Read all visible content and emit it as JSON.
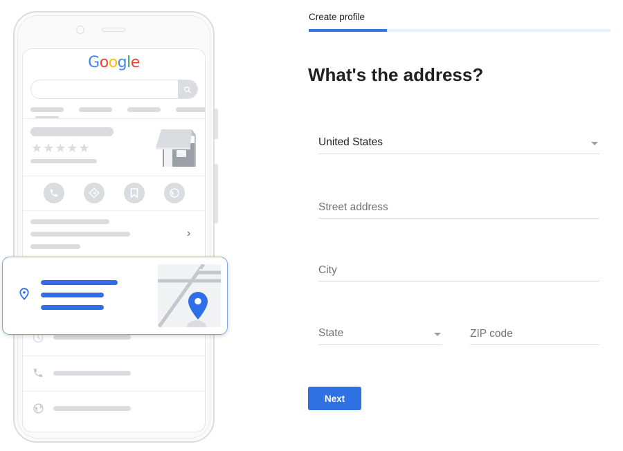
{
  "illustration": {
    "logo": [
      {
        "char": "G",
        "color": "#4285f4"
      },
      {
        "char": "o",
        "color": "#ea4335"
      },
      {
        "char": "o",
        "color": "#fbbc05"
      },
      {
        "char": "g",
        "color": "#4285f4"
      },
      {
        "char": "l",
        "color": "#34a853"
      },
      {
        "char": "e",
        "color": "#ea4335"
      }
    ],
    "rating_stars": "★★★★★",
    "chevron": "›"
  },
  "form": {
    "step_label": "Create profile",
    "progress": 0.26,
    "title": "What's the address?",
    "country": {
      "value": "United States"
    },
    "street": {
      "placeholder": "Street address",
      "value": ""
    },
    "city": {
      "placeholder": "City",
      "value": ""
    },
    "state": {
      "placeholder": "State"
    },
    "zip": {
      "placeholder": "ZIP code",
      "value": ""
    },
    "next_label": "Next"
  },
  "colors": {
    "accent": "#2f71e3",
    "progress_track": "#e8f0fe",
    "placeholder": "#70757a",
    "skeleton": "#dadce0"
  }
}
